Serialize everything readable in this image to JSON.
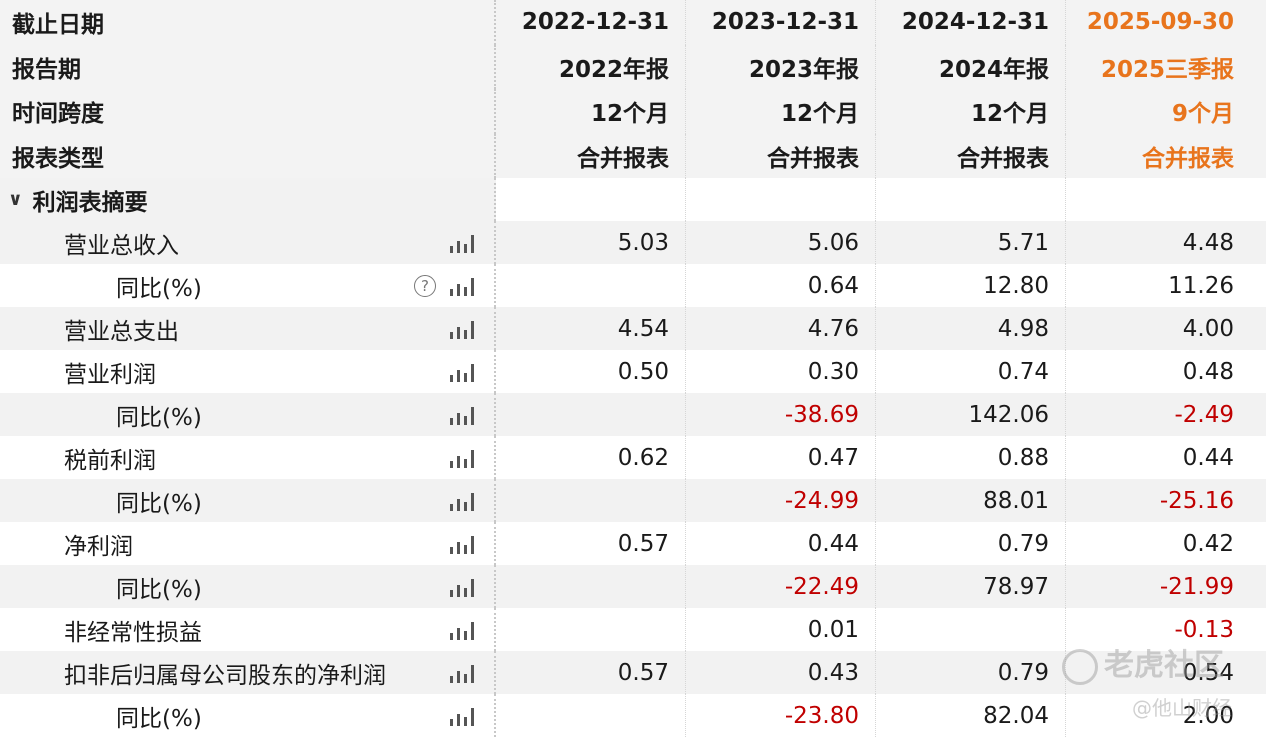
{
  "header": {
    "rows": [
      {
        "label": "截止日期",
        "values": [
          "2022-12-31",
          "2023-12-31",
          "2024-12-31",
          "2025-09-30"
        ]
      },
      {
        "label": "报告期",
        "values": [
          "2022年报",
          "2023年报",
          "2024年报",
          "2025三季报"
        ]
      },
      {
        "label": "时间跨度",
        "values": [
          "12个月",
          "12个月",
          "12个月",
          "9个月"
        ]
      },
      {
        "label": "报表类型",
        "values": [
          "合并报表",
          "合并报表",
          "合并报表",
          "合并报表"
        ]
      }
    ],
    "highlight_color": "#e8741c"
  },
  "section": {
    "title": "利润表摘要",
    "icon": "chevron-down-icon"
  },
  "rows": [
    {
      "label": "营业总收入",
      "values": [
        "5.03",
        "5.06",
        "5.71",
        "4.48"
      ],
      "indent": 1
    },
    {
      "label": "同比(%)",
      "values": [
        "",
        "0.64",
        "12.80",
        "11.26"
      ],
      "indent": 2,
      "help": "?"
    },
    {
      "label": "营业总支出",
      "values": [
        "4.54",
        "4.76",
        "4.98",
        "4.00"
      ],
      "indent": 1
    },
    {
      "label": "营业利润",
      "values": [
        "0.50",
        "0.30",
        "0.74",
        "0.48"
      ],
      "indent": 1
    },
    {
      "label": "同比(%)",
      "values": [
        "",
        "-38.69",
        "142.06",
        "-2.49"
      ],
      "indent": 2
    },
    {
      "label": "税前利润",
      "values": [
        "0.62",
        "0.47",
        "0.88",
        "0.44"
      ],
      "indent": 1
    },
    {
      "label": "同比(%)",
      "values": [
        "",
        "-24.99",
        "88.01",
        "-25.16"
      ],
      "indent": 2
    },
    {
      "label": "净利润",
      "values": [
        "0.57",
        "0.44",
        "0.79",
        "0.42"
      ],
      "indent": 1
    },
    {
      "label": "同比(%)",
      "values": [
        "",
        "-22.49",
        "78.97",
        "-21.99"
      ],
      "indent": 2
    },
    {
      "label": "非经常性损益",
      "values": [
        "",
        "0.01",
        "",
        "-0.13"
      ],
      "indent": 1
    },
    {
      "label": "扣非后归属母公司股东的净利润",
      "values": [
        "0.57",
        "0.43",
        "0.79",
        "0.54"
      ],
      "indent": 1
    },
    {
      "label": "同比(%)",
      "values": [
        "",
        "-23.80",
        "82.04",
        "2.00"
      ],
      "indent": 2
    }
  ],
  "negative_color": "#c00000",
  "watermark": {
    "line1": "老虎社区",
    "line2": "@他山财经"
  }
}
